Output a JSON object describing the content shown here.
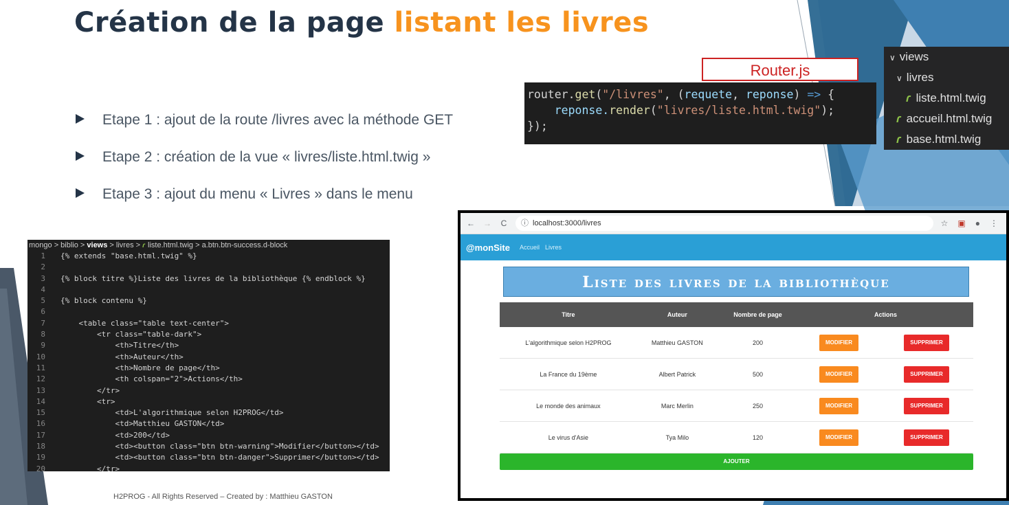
{
  "slide": {
    "title_main": "Création de la page ",
    "title_accent": "listant les livres",
    "bullets": [
      "Etape 1 : ajout de la route /livres avec la méthode GET",
      "Etape 2 : création de la vue « livres/liste.html.twig »",
      "Etape 3 : ajout du menu « Livres » dans le menu"
    ],
    "footer": "H2PROG - All Rights Reserved – Created by : Matthieu GASTON"
  },
  "router": {
    "label": "Router.js",
    "line1_a": "router.",
    "line1_fn": "get",
    "line1_b": "(",
    "line1_str": "\"/livres\"",
    "line1_c": ", (",
    "line1_p1": "requete",
    "line1_d": ", ",
    "line1_p2": "reponse",
    "line1_e": ") ",
    "line1_arrow": "=>",
    "line1_f": " {",
    "line2_a": "    reponse.",
    "line2_fn": "render",
    "line2_b": "(",
    "line2_str": "\"livres/liste.html.twig\"",
    "line2_c": ");",
    "line3": "});"
  },
  "explorer": {
    "items": [
      {
        "label": "views",
        "type": "folder"
      },
      {
        "label": "livres",
        "type": "folder"
      },
      {
        "label": "liste.html.twig",
        "type": "file"
      },
      {
        "label": "accueil.html.twig",
        "type": "file"
      },
      {
        "label": "base.html.twig",
        "type": "file"
      }
    ]
  },
  "editor": {
    "breadcrumb_pre": "mongo > biblio > ",
    "breadcrumb_bold": "views",
    "breadcrumb_post": " > livres > ",
    "breadcrumb_file": "liste.html.twig",
    "breadcrumb_end": " > a.btn.btn-success.d-block",
    "lines": [
      {
        "n": "1",
        "text": "{% extends \"base.html.twig\" %}"
      },
      {
        "n": "2",
        "text": ""
      },
      {
        "n": "3",
        "text": "{% block titre %}Liste des livres de la bibliothèque {% endblock %}"
      },
      {
        "n": "4",
        "text": ""
      },
      {
        "n": "5",
        "text": "{% block contenu %}"
      },
      {
        "n": "6",
        "text": ""
      },
      {
        "n": "7",
        "text": "    <table class=\"table text-center\">"
      },
      {
        "n": "8",
        "text": "        <tr class=\"table-dark\">"
      },
      {
        "n": "9",
        "text": "            <th>Titre</th>"
      },
      {
        "n": "10",
        "text": "            <th>Auteur</th>"
      },
      {
        "n": "11",
        "text": "            <th>Nombre de page</th>"
      },
      {
        "n": "12",
        "text": "            <th colspan=\"2\">Actions</th>"
      },
      {
        "n": "13",
        "text": "        </tr>"
      },
      {
        "n": "14",
        "text": "        <tr>"
      },
      {
        "n": "15",
        "text": "            <td>L'algorithmique selon H2PROG</td>"
      },
      {
        "n": "16",
        "text": "            <td>Matthieu GASTON</td>"
      },
      {
        "n": "17",
        "text": "            <td>200</td>"
      },
      {
        "n": "18",
        "text": "            <td><button class=\"btn btn-warning\">Modifier</button></td>"
      },
      {
        "n": "19",
        "text": "            <td><button class=\"btn btn-danger\">Supprimer</button></td>"
      },
      {
        "n": "20",
        "text": "        </tr>"
      }
    ]
  },
  "browser": {
    "url": "localhost:3000/livres",
    "brand": "@monSite",
    "nav_links": [
      "Accueil",
      "Livres"
    ],
    "page_title": "Liste des livres de la bibliothèque",
    "columns": [
      "Titre",
      "Auteur",
      "Nombre de page",
      "Actions"
    ],
    "rows": [
      {
        "titre": "L'algorithmique selon H2PROG",
        "auteur": "Matthieu GASTON",
        "pages": "200"
      },
      {
        "titre": "La France du 19ème",
        "auteur": "Albert Patrick",
        "pages": "500"
      },
      {
        "titre": "Le monde des animaux",
        "auteur": "Marc Merlin",
        "pages": "250"
      },
      {
        "titre": "Le virus d'Asie",
        "auteur": "Tya Milo",
        "pages": "120"
      }
    ],
    "modify_label": "MODIFIER",
    "delete_label": "SUPPRIMER",
    "add_label": "AJOUTER"
  }
}
